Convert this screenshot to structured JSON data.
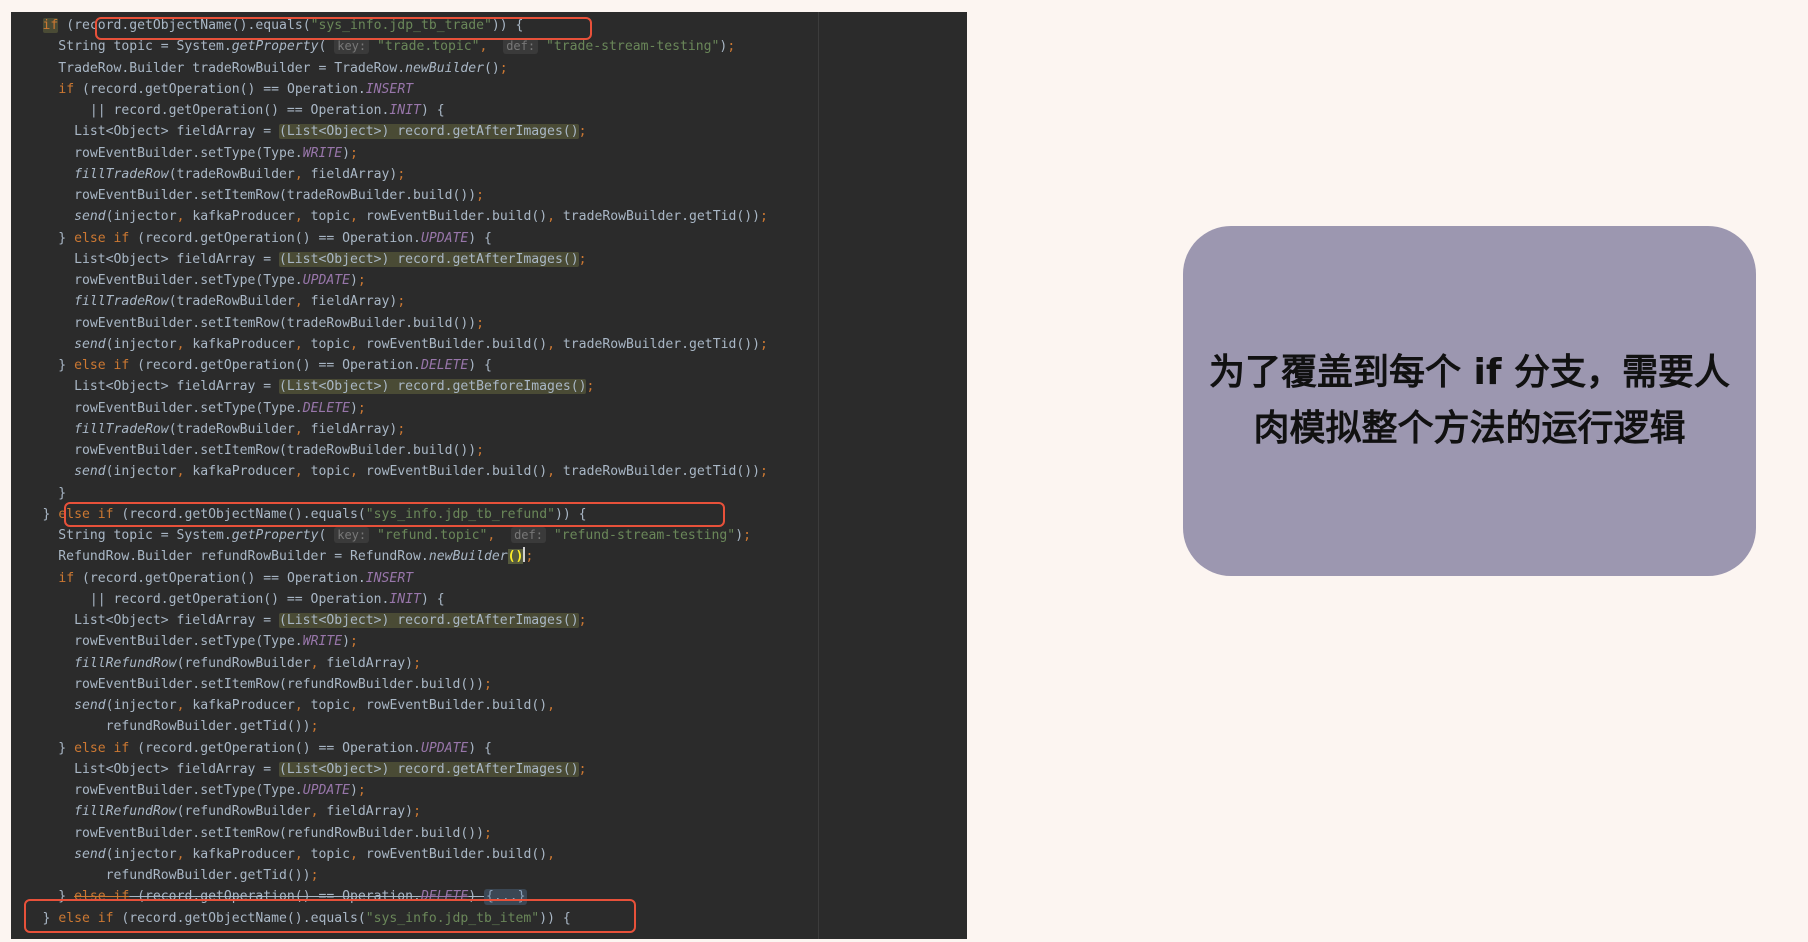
{
  "code_lines": [
    {
      "t": [
        {
          "s": "    "
        },
        {
          "s": "if",
          "c": "kw hl"
        },
        {
          "s": " (record.getObjectName().equals("
        },
        {
          "s": "\"sys_info.jdp_tb_trade\"",
          "c": "str"
        },
        {
          "s": ")) {"
        }
      ]
    },
    {
      "t": [
        {
          "s": "      String topic = System."
        },
        {
          "s": "getProperty",
          "c": "ital"
        },
        {
          "s": "( "
        },
        {
          "s": "key:",
          "c": "hint"
        },
        {
          "s": " "
        },
        {
          "s": "\"trade.topic\"",
          "c": "str"
        },
        {
          "s": ",",
          "c": "kw"
        },
        {
          "s": "  "
        },
        {
          "s": "def:",
          "c": "hint"
        },
        {
          "s": " "
        },
        {
          "s": "\"trade-stream-testing\"",
          "c": "str"
        },
        {
          "s": ")"
        },
        {
          "s": ";",
          "c": "kw"
        }
      ]
    },
    {
      "t": [
        {
          "s": "      TradeRow.Builder tradeRowBuilder = TradeRow."
        },
        {
          "s": "newBuilder",
          "c": "ital"
        },
        {
          "s": "()"
        },
        {
          "s": ";",
          "c": "kw"
        }
      ]
    },
    {
      "t": [
        {
          "s": "      "
        },
        {
          "s": "if",
          "c": "kw"
        },
        {
          "s": " (record.getOperation() == Operation."
        },
        {
          "s": "INSERT",
          "c": "const"
        }
      ]
    },
    {
      "t": [
        {
          "s": "          || record.getOperation() == Operation."
        },
        {
          "s": "INIT",
          "c": "const"
        },
        {
          "s": ") {"
        }
      ]
    },
    {
      "t": [
        {
          "s": "        List<Object> fieldArray = "
        },
        {
          "s": "(List<Object>) record.getAfterImages()",
          "c": "hl"
        },
        {
          "s": ";",
          "c": "kw"
        }
      ]
    },
    {
      "t": [
        {
          "s": "        rowEventBuilder.setType(Type."
        },
        {
          "s": "WRITE",
          "c": "const"
        },
        {
          "s": ")"
        },
        {
          "s": ";",
          "c": "kw"
        }
      ]
    },
    {
      "t": [
        {
          "s": "        "
        },
        {
          "s": "fillTradeRow",
          "c": "ital"
        },
        {
          "s": "(tradeRowBuilder"
        },
        {
          "s": ",",
          "c": "kw"
        },
        {
          "s": " fieldArray)"
        },
        {
          "s": ";",
          "c": "kw"
        }
      ]
    },
    {
      "t": [
        {
          "s": "        rowEventBuilder.setItemRow(tradeRowBuilder.build())"
        },
        {
          "s": ";",
          "c": "kw"
        }
      ]
    },
    {
      "t": [
        {
          "s": "        "
        },
        {
          "s": "send",
          "c": "ital"
        },
        {
          "s": "(injector"
        },
        {
          "s": ",",
          "c": "kw"
        },
        {
          "s": " kafkaProducer"
        },
        {
          "s": ",",
          "c": "kw"
        },
        {
          "s": " topic"
        },
        {
          "s": ",",
          "c": "kw"
        },
        {
          "s": " rowEventBuilder.build()"
        },
        {
          "s": ",",
          "c": "kw"
        },
        {
          "s": " tradeRowBuilder.getTid())"
        },
        {
          "s": ";",
          "c": "kw"
        }
      ]
    },
    {
      "t": [
        {
          "s": "      } "
        },
        {
          "s": "else if",
          "c": "kw"
        },
        {
          "s": " (record.getOperation() == Operation."
        },
        {
          "s": "UPDATE",
          "c": "const"
        },
        {
          "s": ") {"
        }
      ]
    },
    {
      "t": [
        {
          "s": "        List<Object> fieldArray = "
        },
        {
          "s": "(List<Object>) record.getAfterImages()",
          "c": "hl"
        },
        {
          "s": ";",
          "c": "kw"
        }
      ]
    },
    {
      "t": [
        {
          "s": "        rowEventBuilder.setType(Type."
        },
        {
          "s": "UPDATE",
          "c": "const"
        },
        {
          "s": ")"
        },
        {
          "s": ";",
          "c": "kw"
        }
      ]
    },
    {
      "t": [
        {
          "s": "        "
        },
        {
          "s": "fillTradeRow",
          "c": "ital"
        },
        {
          "s": "(tradeRowBuilder"
        },
        {
          "s": ",",
          "c": "kw"
        },
        {
          "s": " fieldArray)"
        },
        {
          "s": ";",
          "c": "kw"
        }
      ]
    },
    {
      "t": [
        {
          "s": "        rowEventBuilder.setItemRow(tradeRowBuilder.build())"
        },
        {
          "s": ";",
          "c": "kw"
        }
      ]
    },
    {
      "t": [
        {
          "s": "        "
        },
        {
          "s": "send",
          "c": "ital"
        },
        {
          "s": "(injector"
        },
        {
          "s": ",",
          "c": "kw"
        },
        {
          "s": " kafkaProducer"
        },
        {
          "s": ",",
          "c": "kw"
        },
        {
          "s": " topic"
        },
        {
          "s": ",",
          "c": "kw"
        },
        {
          "s": " rowEventBuilder.build()"
        },
        {
          "s": ",",
          "c": "kw"
        },
        {
          "s": " tradeRowBuilder.getTid())"
        },
        {
          "s": ";",
          "c": "kw"
        }
      ]
    },
    {
      "t": [
        {
          "s": "      } "
        },
        {
          "s": "else if",
          "c": "kw"
        },
        {
          "s": " (record.getOperation() == Operation."
        },
        {
          "s": "DELETE",
          "c": "const"
        },
        {
          "s": ") {"
        }
      ]
    },
    {
      "t": [
        {
          "s": "        List<Object> fieldArray = "
        },
        {
          "s": "(List<Object>) record.getBeforeImages()",
          "c": "hl"
        },
        {
          "s": ";",
          "c": "kw"
        }
      ]
    },
    {
      "t": [
        {
          "s": "        rowEventBuilder.setType(Type."
        },
        {
          "s": "DELETE",
          "c": "const"
        },
        {
          "s": ")"
        },
        {
          "s": ";",
          "c": "kw"
        }
      ]
    },
    {
      "t": [
        {
          "s": "        "
        },
        {
          "s": "fillTradeRow",
          "c": "ital"
        },
        {
          "s": "(tradeRowBuilder"
        },
        {
          "s": ",",
          "c": "kw"
        },
        {
          "s": " fieldArray)"
        },
        {
          "s": ";",
          "c": "kw"
        }
      ]
    },
    {
      "t": [
        {
          "s": "        rowEventBuilder.setItemRow(tradeRowBuilder.build())"
        },
        {
          "s": ";",
          "c": "kw"
        }
      ]
    },
    {
      "t": [
        {
          "s": "        "
        },
        {
          "s": "send",
          "c": "ital"
        },
        {
          "s": "(injector"
        },
        {
          "s": ",",
          "c": "kw"
        },
        {
          "s": " kafkaProducer"
        },
        {
          "s": ",",
          "c": "kw"
        },
        {
          "s": " topic"
        },
        {
          "s": ",",
          "c": "kw"
        },
        {
          "s": " rowEventBuilder.build()"
        },
        {
          "s": ",",
          "c": "kw"
        },
        {
          "s": " tradeRowBuilder.getTid())"
        },
        {
          "s": ";",
          "c": "kw"
        }
      ]
    },
    {
      "t": [
        {
          "s": "      }"
        }
      ]
    },
    {
      "t": [
        {
          "s": "    } "
        },
        {
          "s": "else if",
          "c": "kw"
        },
        {
          "s": " (record.getObjectName().equals("
        },
        {
          "s": "\"sys_info.jdp_tb_refund\"",
          "c": "str"
        },
        {
          "s": ")) {"
        }
      ]
    },
    {
      "t": [
        {
          "s": "      String topic = System."
        },
        {
          "s": "getProperty",
          "c": "ital"
        },
        {
          "s": "( "
        },
        {
          "s": "key:",
          "c": "hint"
        },
        {
          "s": " "
        },
        {
          "s": "\"refund.topic\"",
          "c": "str"
        },
        {
          "s": ",",
          "c": "kw"
        },
        {
          "s": "  "
        },
        {
          "s": "def:",
          "c": "hint"
        },
        {
          "s": " "
        },
        {
          "s": "\"refund-stream-testing\"",
          "c": "str"
        },
        {
          "s": ")"
        },
        {
          "s": ";",
          "c": "kw"
        }
      ]
    },
    {
      "t": [
        {
          "s": "      RefundRow.Builder refundRowBuilder = RefundRow."
        },
        {
          "s": "newBuilder",
          "c": "ital"
        },
        {
          "s": "()",
          "c": "hlb"
        },
        {
          "s": "",
          "c": "cursor"
        },
        {
          "s": ";",
          "c": "kw"
        }
      ]
    },
    {
      "t": [
        {
          "s": "      "
        },
        {
          "s": "if",
          "c": "kw"
        },
        {
          "s": " (record.getOperation() == Operation."
        },
        {
          "s": "INSERT",
          "c": "const"
        }
      ]
    },
    {
      "t": [
        {
          "s": "          || record.getOperation() == Operation."
        },
        {
          "s": "INIT",
          "c": "const"
        },
        {
          "s": ") {"
        }
      ]
    },
    {
      "t": [
        {
          "s": "        List<Object> fieldArray = "
        },
        {
          "s": "(List<Object>) record.getAfterImages()",
          "c": "hl"
        },
        {
          "s": ";",
          "c": "kw"
        }
      ]
    },
    {
      "t": [
        {
          "s": "        rowEventBuilder.setType(Type."
        },
        {
          "s": "WRITE",
          "c": "const"
        },
        {
          "s": ")"
        },
        {
          "s": ";",
          "c": "kw"
        }
      ]
    },
    {
      "t": [
        {
          "s": "        "
        },
        {
          "s": "fillRefundRow",
          "c": "ital"
        },
        {
          "s": "(refundRowBuilder"
        },
        {
          "s": ",",
          "c": "kw"
        },
        {
          "s": " fieldArray)"
        },
        {
          "s": ";",
          "c": "kw"
        }
      ]
    },
    {
      "t": [
        {
          "s": "        rowEventBuilder.setItemRow(refundRowBuilder.build())"
        },
        {
          "s": ";",
          "c": "kw"
        }
      ]
    },
    {
      "t": [
        {
          "s": "        "
        },
        {
          "s": "send",
          "c": "ital"
        },
        {
          "s": "(injector"
        },
        {
          "s": ",",
          "c": "kw"
        },
        {
          "s": " kafkaProducer"
        },
        {
          "s": ",",
          "c": "kw"
        },
        {
          "s": " topic"
        },
        {
          "s": ",",
          "c": "kw"
        },
        {
          "s": " rowEventBuilder.build()"
        },
        {
          "s": ",",
          "c": "kw"
        }
      ]
    },
    {
      "t": [
        {
          "s": "            refundRowBuilder.getTid())"
        },
        {
          "s": ";",
          "c": "kw"
        }
      ]
    },
    {
      "t": [
        {
          "s": "      } "
        },
        {
          "s": "else if",
          "c": "kw"
        },
        {
          "s": " (record.getOperation() == Operation."
        },
        {
          "s": "UPDATE",
          "c": "const"
        },
        {
          "s": ") {"
        }
      ]
    },
    {
      "t": [
        {
          "s": "        List<Object> fieldArray = "
        },
        {
          "s": "(List<Object>) record.getAfterImages()",
          "c": "hl"
        },
        {
          "s": ";",
          "c": "kw"
        }
      ]
    },
    {
      "t": [
        {
          "s": "        rowEventBuilder.setType(Type."
        },
        {
          "s": "UPDATE",
          "c": "const"
        },
        {
          "s": ")"
        },
        {
          "s": ";",
          "c": "kw"
        }
      ]
    },
    {
      "t": [
        {
          "s": "        "
        },
        {
          "s": "fillRefundRow",
          "c": "ital"
        },
        {
          "s": "(refundRowBuilder"
        },
        {
          "s": ",",
          "c": "kw"
        },
        {
          "s": " fieldArray)"
        },
        {
          "s": ";",
          "c": "kw"
        }
      ]
    },
    {
      "t": [
        {
          "s": "        rowEventBuilder.setItemRow(refundRowBuilder.build())"
        },
        {
          "s": ";",
          "c": "kw"
        }
      ]
    },
    {
      "t": [
        {
          "s": "        "
        },
        {
          "s": "send",
          "c": "ital"
        },
        {
          "s": "(injector"
        },
        {
          "s": ",",
          "c": "kw"
        },
        {
          "s": " kafkaProducer"
        },
        {
          "s": ",",
          "c": "kw"
        },
        {
          "s": " topic"
        },
        {
          "s": ",",
          "c": "kw"
        },
        {
          "s": " rowEventBuilder.build()"
        },
        {
          "s": ",",
          "c": "kw"
        }
      ]
    },
    {
      "t": [
        {
          "s": "            refundRowBuilder.getTid())"
        },
        {
          "s": ";",
          "c": "kw"
        }
      ]
    },
    {
      "t": [
        {
          "s": "      } "
        },
        {
          "s": "else if",
          "c": "kw strike"
        },
        {
          "s": " (record.getOperation() == Operation.",
          "c": "strike"
        },
        {
          "s": "DELETE",
          "c": "const strike"
        },
        {
          "s": ") ",
          "c": "strike"
        },
        {
          "s": "{...}",
          "c": "fold"
        }
      ]
    },
    {
      "t": [
        {
          "s": "    } "
        },
        {
          "s": "else if",
          "c": "kw"
        },
        {
          "s": " (record.getObjectName().equals("
        },
        {
          "s": "\"sys_info.jdp_tb_item\"",
          "c": "str"
        },
        {
          "s": ")) {"
        }
      ]
    }
  ],
  "callout": {
    "lines": [
      "为了覆盖到每个 if 分支，需要人",
      "肉模拟整个方法的运行逻辑"
    ]
  }
}
